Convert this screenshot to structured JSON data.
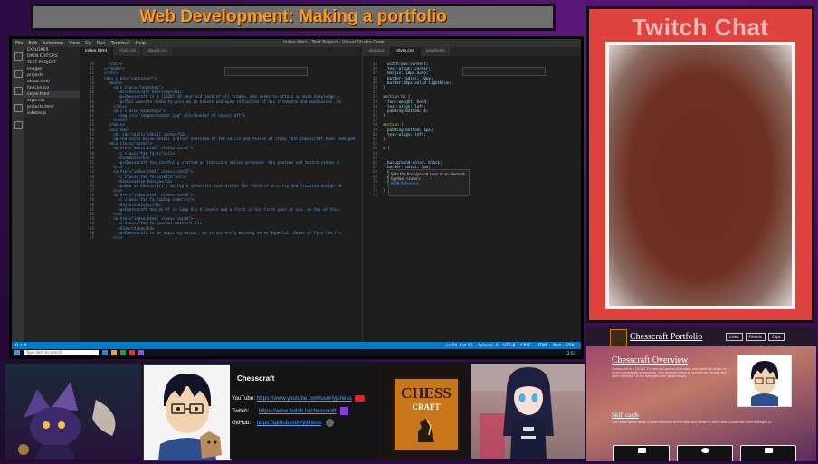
{
  "banner": {
    "title": "Web Development: Making a portfolio"
  },
  "vscode": {
    "window_title": "index.html - Test Project - Visual Studio Code",
    "menu": [
      "File",
      "Edit",
      "Selection",
      "View",
      "Go",
      "Run",
      "Terminal",
      "Help"
    ],
    "explorer": {
      "header": "EXPLORER",
      "sections": [
        "OPEN EDITORS",
        "TEST PROJECT"
      ],
      "items": [
        "images",
        "projects",
        "about.html",
        "favicon.ico",
        "index.html",
        "style.css",
        "projects.html",
        "sidebar.js"
      ]
    },
    "tabs_left": [
      "index.html",
      "style.css",
      "about.css"
    ],
    "tabs_right": [
      "aboutus",
      "style.css",
      "pagelinks"
    ],
    "code_left": [
      {
        "n": "30",
        "t": "    </div>"
      },
      {
        "n": "31",
        "t": "  </header>"
      },
      {
        "n": "32",
        "t": "  </div>"
      },
      {
        "n": "33",
        "t": "  <div class=\"container\">"
      },
      {
        "n": "34",
        "t": "    <main>"
      },
      {
        "n": "35",
        "t": "      <div class=\"headshot\">"
      },
      {
        "n": "36",
        "t": "        <h1>Chesscraft Overview</h1>"
      },
      {
        "n": "37",
        "t": "        <p>Chesscraft is a [2020] 19 year old jack of all trades, who seeks to attain as much knowledge a"
      },
      {
        "n": "38",
        "t": "        <p>This website seeks to provide an honest and open reflection of his strengths and weaknesses. Hi"
      },
      {
        "n": "39",
        "t": "      </div>"
      },
      {
        "n": "40",
        "t": "      <div class=\"headshot2\">"
      },
      {
        "n": "41",
        "t": "        <img src=\"images/avatar.jpg\" alt=\"avatar of chesscraft\">"
      },
      {
        "n": "42",
        "t": "      </div>"
      },
      {
        "n": "43",
        "t": "    </main>"
      },
      {
        "n": "44",
        "t": "    <section>"
      },
      {
        "n": "45",
        "t": "      <h2 id=\"skills\">Skill cards</h2>"
      },
      {
        "n": "46",
        "t": "      <p>The cards below detail a brief overview of the skills and fields of study that Chesscraft have indulged"
      },
      {
        "n": "47",
        "t": "    <div class=\"cards\">"
      },
      {
        "n": "48",
        "t": "      <a href=\"media.html\" class=\"card1\">"
      },
      {
        "n": "49",
        "t": "        <i class=\"fas fa-tv\"></i>"
      },
      {
        "n": "50",
        "t": "        <h3>Media</h3>"
      },
      {
        "n": "51",
        "t": "        <p>Chesscraft has carefully crafted an intricate online presence. His youtube and twitch videos d"
      },
      {
        "n": "52",
        "t": "      </a>"
      },
      {
        "n": "53",
        "t": "      <a href=\"index.html\" class=\"card2\">"
      },
      {
        "n": "54",
        "t": "        <i class=\"fas fa-palette\"></i>"
      },
      {
        "n": "55",
        "t": "        <h3>Creative Design</h3>"
      },
      {
        "n": "56",
        "t": "        <p>One of Chesscraft's multiple interests lies within the field of artistry and creative design. W"
      },
      {
        "n": "57",
        "t": "      </a>"
      },
      {
        "n": "58",
        "t": "      <a href=\"index.html\" class=\"card3\">"
      },
      {
        "n": "59",
        "t": "        <i class=\"fas fa-laptop-code\"></i>"
      },
      {
        "n": "60",
        "t": "        <h3>Technology</h3>"
      },
      {
        "n": "61",
        "t": "        <p>Chesscraft has an A* in Comp Sci A levels and a first in his first year at uni. On top of this,"
      },
      {
        "n": "62",
        "t": "      </a>"
      },
      {
        "n": "63",
        "t": "      <a href=\"index.html\" class=\"card4\">"
      },
      {
        "n": "64",
        "t": "        <i class=\"fas fa-journal-whills\"></i>"
      },
      {
        "n": "65",
        "t": "        <h3>Writing</h3>"
      },
      {
        "n": "66",
        "t": "        <p>Chesscraft is an aspiring author, he is currently working on an Imperial: Gates of Fyra fan fic"
      },
      {
        "n": "67",
        "t": "      </a>"
      }
    ],
    "code_right": [
      {
        "n": "45",
        "t": "  width:max-content;"
      },
      {
        "n": "46",
        "t": "  text-align: center;"
      },
      {
        "n": "47",
        "t": "  margin: 10px auto;"
      },
      {
        "n": "48",
        "t": "  border-radius: 10px;"
      },
      {
        "n": "49",
        "t": "  border:10px solid lightblue;"
      },
      {
        "n": "50",
        "t": "}"
      },
      {
        "n": "51",
        "t": ""
      },
      {
        "n": "52",
        "t": "section h2 {"
      },
      {
        "n": "53",
        "t": "  font-weight: bold;"
      },
      {
        "n": "54",
        "t": "  text-align: left;"
      },
      {
        "n": "55",
        "t": "  padding-bottom: 0;"
      },
      {
        "n": "56",
        "t": "}"
      },
      {
        "n": "57",
        "t": ""
      },
      {
        "n": "58",
        "t": "section {"
      },
      {
        "n": "59",
        "t": "  padding-bottom: 1px;"
      },
      {
        "n": "60",
        "t": "  text-align: left;"
      },
      {
        "n": "61",
        "t": "}"
      },
      {
        "n": "62",
        "t": ""
      },
      {
        "n": "63",
        "t": "a {"
      },
      {
        "n": "64",
        "t": ""
      },
      {
        "n": "65",
        "t": ""
      },
      {
        "n": "66",
        "t": "  background-color: black;"
      },
      {
        "n": "67",
        "t": "  border-radius: 5px;"
      },
      {
        "n": "68",
        "t": "  display:inline-block;"
      },
      {
        "n": "69",
        "t": "  padding:0.5rem;"
      },
      {
        "n": "70",
        "t": "  margin-bottom: 1px;"
      },
      {
        "n": "71",
        "t": "  text-align: left;"
      },
      {
        "n": "72",
        "t": "}"
      },
      {
        "n": "73",
        "t": ""
      }
    ],
    "hover_tip": {
      "line1": "Sets the background color of an element.",
      "line2": "Syntax: <color>",
      "line3": "MDN Reference"
    },
    "status_left": [
      "0 ⚠ 0",
      "Ln 54, Col 13"
    ],
    "status_right": [
      "Spaces: 4",
      "UTF-8",
      "CRLF",
      "HTML",
      "Port : 5500"
    ],
    "taskbar_search": "Type here to search",
    "clock": "12:53"
  },
  "twitch_chat": {
    "title": "Twitch Chat"
  },
  "portfolio_site": {
    "site_name": "Chesscraft Portfolio",
    "nav_links": [
      "Links",
      "Friends",
      "Clips"
    ],
    "heading": "Chesscraft Overview",
    "paragraph": "Chesscraft is a [2020] 19 year old jack of all trades, who seeks to attain as much knowledge as possible. This website seeks to provide an honest and open reflection of his strengths and weaknesses.",
    "skills_heading": "Skill cards",
    "skills_paragraph": "The cards below detail a brief overview of the skills and fields of study that Chesscraft have indulged in."
  },
  "streamer_card": {
    "name": "Chesscraft",
    "youtube_label": "YouTube:",
    "youtube_url": "https://www.youtube.com/user/yjchess",
    "twitch_label": "Twitch:",
    "twitch_url": "https://www.twitch.tv/chesscraft",
    "github_label": "GitHub:",
    "github_url": "https://github.com/yjchess"
  },
  "chess_logo": {
    "line1": "CHESS",
    "line2": "CRAFT"
  },
  "colors": {
    "banner_text": "#ff9a1a",
    "chat_red": "#e0423e",
    "vscode_blue": "#007acc",
    "link_blue": "#4aa3ff"
  }
}
